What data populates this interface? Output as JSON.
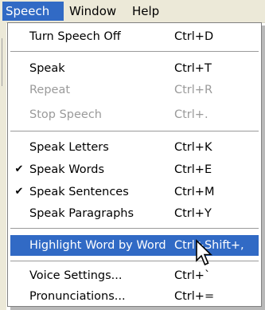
{
  "menubar": {
    "speech": "Speech",
    "window": "Window",
    "help": "Help"
  },
  "menu": {
    "turn_speech_off": {
      "label": "Turn Speech Off",
      "shortcut": "Ctrl+D"
    },
    "speak": {
      "label": "Speak",
      "shortcut": "Ctrl+T"
    },
    "repeat": {
      "label": "Repeat",
      "shortcut": "Ctrl+R"
    },
    "stop_speech": {
      "label": "Stop Speech",
      "shortcut": "Ctrl+."
    },
    "speak_letters": {
      "label": "Speak Letters",
      "shortcut": "Ctrl+K"
    },
    "speak_words": {
      "label": "Speak Words",
      "shortcut": "Ctrl+E",
      "check": "✔"
    },
    "speak_sentences": {
      "label": "Speak Sentences",
      "shortcut": "Ctrl+M",
      "check": "✔"
    },
    "speak_paragraphs": {
      "label": "Speak Paragraphs",
      "shortcut": "Ctrl+Y"
    },
    "highlight_word": {
      "label": "Highlight Word by Word",
      "shortcut": "Ctrl+Shift+,"
    },
    "voice_settings": {
      "label": "Voice Settings...",
      "shortcut": "Ctrl+`"
    },
    "pronunciations": {
      "label": "Pronunciations...",
      "shortcut": "Ctrl+="
    }
  },
  "colors": {
    "highlight": "#316ac5",
    "disabled_text": "#9a9a9a",
    "menubar_bg": "#ece9d8"
  },
  "icons": {
    "cursor": "arrow-cursor-icon",
    "check": "checkmark-icon"
  }
}
